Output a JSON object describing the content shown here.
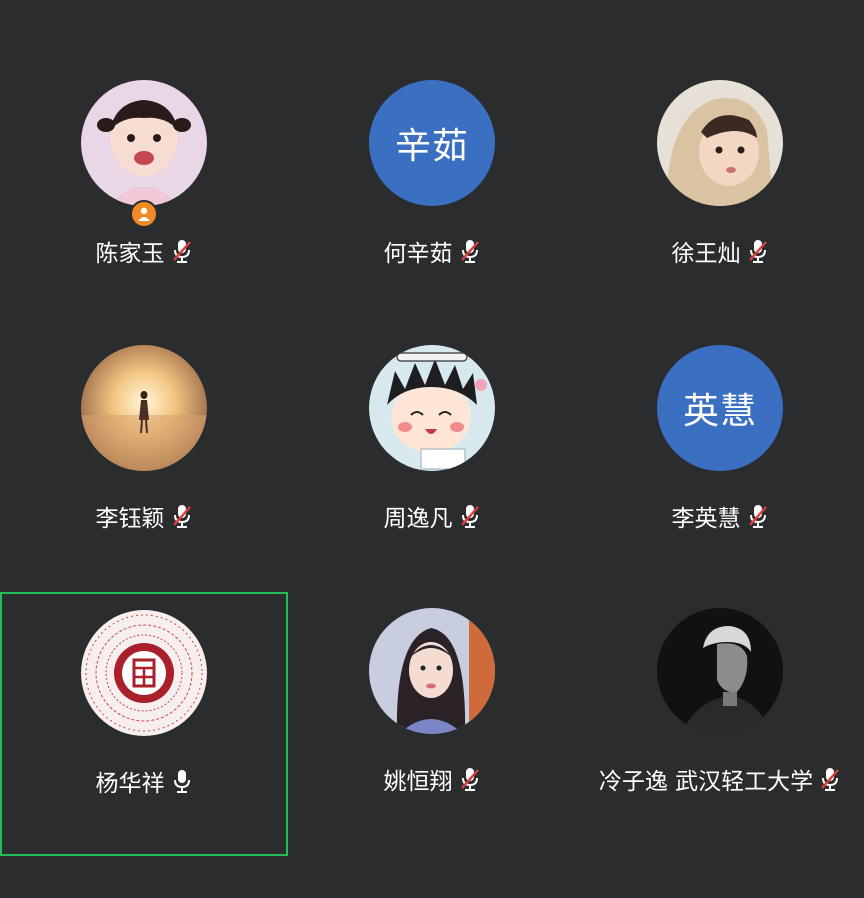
{
  "colors": {
    "background": "#2b2c2e",
    "avatar_text_bg": "#3b6fc1",
    "active_border": "#1fbe5b",
    "host_badge": "#f08a24",
    "mute_slash": "#e03b3b",
    "text": "#ffffff"
  },
  "participants": [
    {
      "name": "陈家玉",
      "avatar_type": "image",
      "avatar_icon": "girl-photo-avatar",
      "host": true,
      "mic": "muted",
      "active": false
    },
    {
      "name": "何辛茹",
      "avatar_type": "text",
      "avatar_text": "辛茹",
      "host": false,
      "mic": "muted",
      "active": false
    },
    {
      "name": "徐王灿",
      "avatar_type": "image",
      "avatar_icon": "child-photo-avatar",
      "host": false,
      "mic": "muted",
      "active": false
    },
    {
      "name": "李钰颖",
      "avatar_type": "image",
      "avatar_icon": "sunset-silhouette-avatar",
      "host": false,
      "mic": "muted",
      "active": false
    },
    {
      "name": "周逸凡",
      "avatar_type": "image",
      "avatar_icon": "cartoon-girl-avatar",
      "host": false,
      "mic": "muted",
      "active": false
    },
    {
      "name": "李英慧",
      "avatar_type": "text",
      "avatar_text": "英慧",
      "host": false,
      "mic": "muted",
      "active": false
    },
    {
      "name": "杨华祥",
      "avatar_type": "image",
      "avatar_icon": "seal-emblem-avatar",
      "host": false,
      "mic": "on",
      "active": true
    },
    {
      "name": "姚恒翔",
      "avatar_type": "image",
      "avatar_icon": "woman-photo-avatar",
      "host": false,
      "mic": "muted",
      "active": false
    },
    {
      "name": "冷子逸 武汉轻工大学",
      "avatar_type": "image",
      "avatar_icon": "man-monochrome-avatar",
      "host": false,
      "mic": "muted",
      "active": false
    }
  ]
}
